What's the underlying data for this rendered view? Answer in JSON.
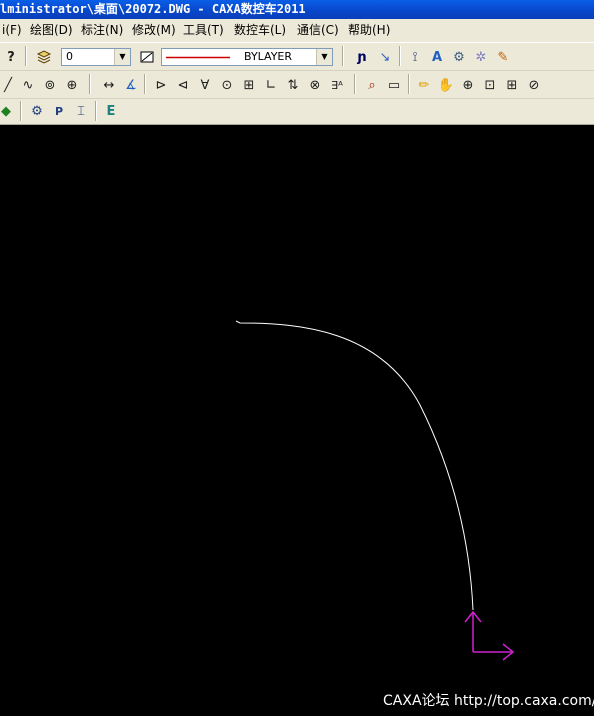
{
  "window": {
    "title": "lministrator\\桌面\\20072.DWG - CAXA数控车2011"
  },
  "menu": [
    {
      "label": "i(F)"
    },
    {
      "label": "绘图(D)"
    },
    {
      "label": "标注(N)"
    },
    {
      "label": "修改(M)"
    },
    {
      "label": "工具(T)"
    },
    {
      "label": "数控车(L)"
    },
    {
      "label": "通信(C)"
    },
    {
      "label": "帮助(H)"
    }
  ],
  "properties_toolbar": {
    "layer_value": "0",
    "linetype_value": "BYLAYER",
    "line_color": "#cc0000"
  },
  "icons": {
    "help": "help-icon",
    "layers": "layer-manager-icon",
    "linetype": "linetype-icon"
  },
  "drawing": {
    "curve_color": "#ffffff",
    "axis_color": "#d020d0"
  },
  "watermark": {
    "text": "CAXA论坛 http://top.caxa.com/"
  }
}
